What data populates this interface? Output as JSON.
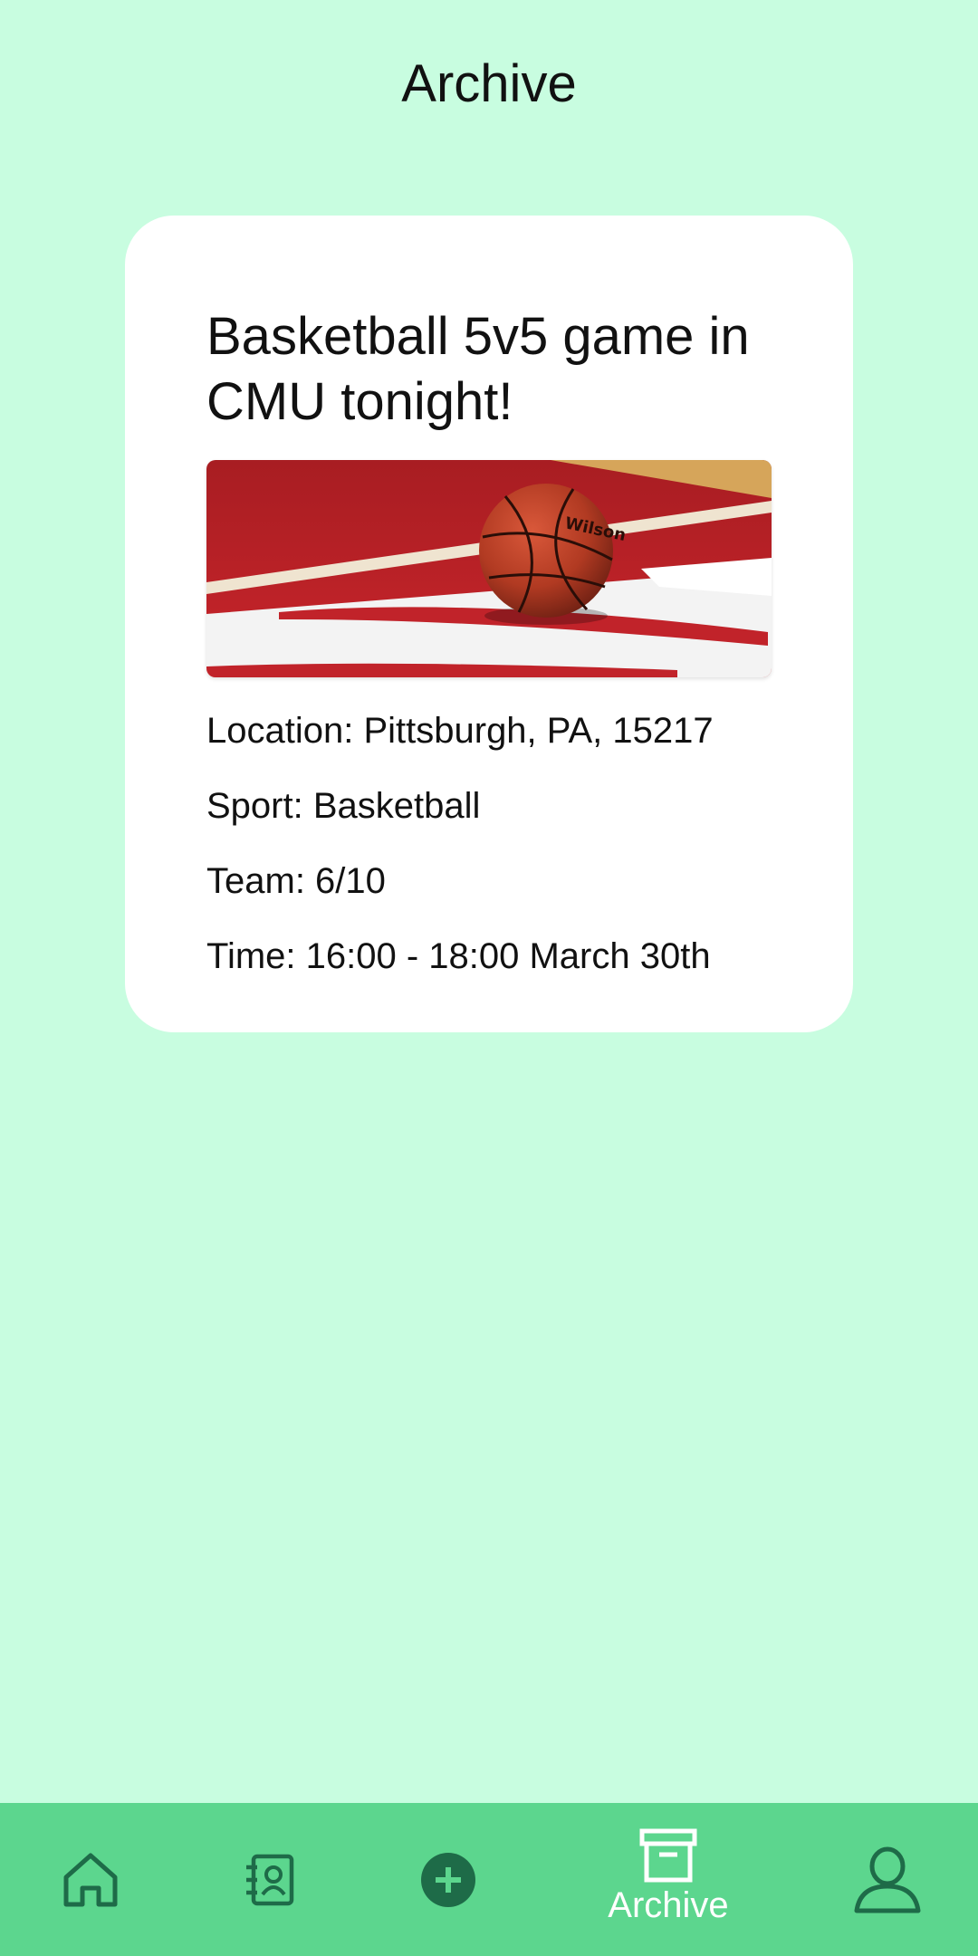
{
  "header": {
    "title": "Archive"
  },
  "event": {
    "title": "Basketball 5v5 game in CMU tonight!",
    "image_alt": "Basketball on a red and white court",
    "location": "Location: Pittsburgh, PA, 15217",
    "sport": "Sport: Basketball",
    "team": "Team: 6/10",
    "time": "Time: 16:00 - 18:00 March 30th"
  },
  "bottom_nav": {
    "items": [
      {
        "icon": "home-icon",
        "label": ""
      },
      {
        "icon": "contacts-icon",
        "label": ""
      },
      {
        "icon": "add-circle-icon",
        "label": ""
      },
      {
        "icon": "archive-icon",
        "label": "Archive",
        "active": true
      },
      {
        "icon": "profile-icon",
        "label": ""
      }
    ]
  },
  "colors": {
    "background": "#c8fde0",
    "card": "#ffffff",
    "nav_bar": "#5cd68e",
    "nav_icon": "#1e6b48",
    "nav_active": "#ffffff"
  }
}
